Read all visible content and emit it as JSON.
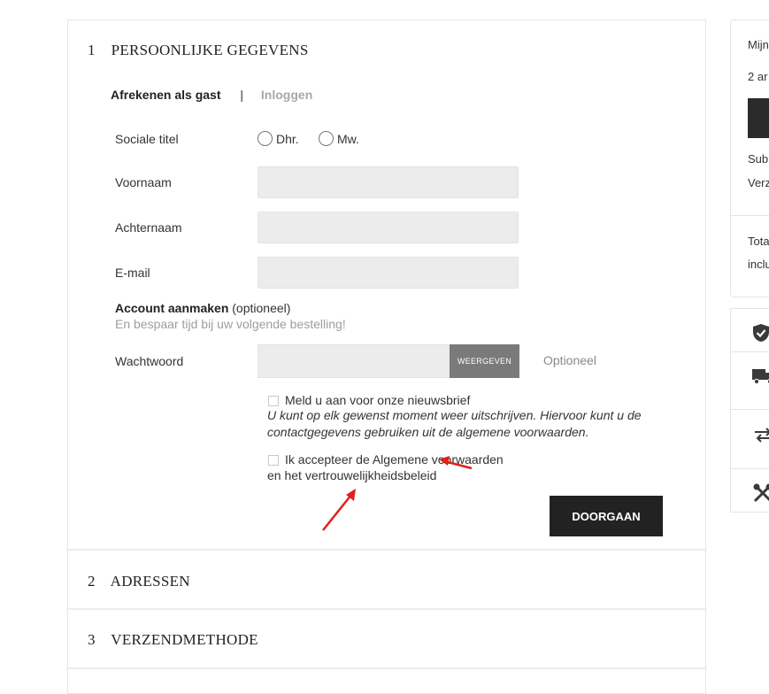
{
  "checkout": {
    "step1": {
      "number": "1",
      "title": "PERSOONLIJKE GEGEVENS"
    },
    "tabs": {
      "guest": "Afrekenen als gast",
      "separator": "|",
      "login": "Inloggen"
    },
    "form": {
      "social_title_label": "Sociale titel",
      "radio_mr": "Dhr.",
      "radio_mrs": "Mw.",
      "firstname_label": "Voornaam",
      "lastname_label": "Achternaam",
      "email_label": "E-mail",
      "account_title": "Account aanmaken",
      "account_optional": "(optioneel)",
      "account_sub": "En bespaar tijd bij uw volgende bestelling!",
      "password_label": "Wachtwoord",
      "show_button": "WEERGEVEN",
      "optional_hint": "Optioneel",
      "newsletter_label": "Meld u aan voor onze nieuwsbrief",
      "newsletter_note": "U kunt op elk gewenst moment weer uitschrijven. Hiervoor kunt u de contactgegevens gebruiken uit de algemene voorwaarden.",
      "terms_line1": "Ik accepteer de Algemene voorwaarden",
      "terms_line2": "en het vertrouwelijkheidsbeleid",
      "continue_button": "DOORGAAN"
    },
    "step2": {
      "number": "2",
      "title": "ADRESSEN"
    },
    "step3": {
      "number": "3",
      "title": "VERZENDMETHODE"
    }
  },
  "sidebar": {
    "title": "Mijn",
    "items_count": "2 ar",
    "subtotal": "Sub",
    "shipping": "Verz",
    "total": "Tota",
    "incl": "inclu"
  },
  "trust_icons": [
    "shield-check-icon",
    "truck-icon",
    "exchange-arrows-icon",
    "tools-icon"
  ],
  "colors": {
    "dark_button": "#2b2b2b",
    "grey_button": "#7a7a7a",
    "input_bg": "#ececec",
    "annotation_arrow": "#e0201b"
  }
}
